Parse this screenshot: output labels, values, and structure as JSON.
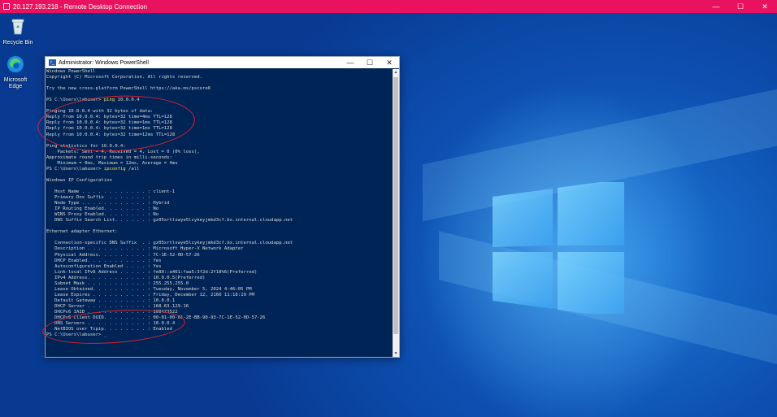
{
  "rdp": {
    "title": "20.127.193.218 - Remote Desktop Connection",
    "controls": [
      "—",
      "☐",
      "✕"
    ]
  },
  "desktop": {
    "icons": [
      {
        "label": "Recycle Bin",
        "icon": "recycle-bin-icon"
      },
      {
        "label": "Microsoft Edge",
        "icon": "edge-icon"
      }
    ]
  },
  "powershell": {
    "title": "Administrator: Windows PowerShell",
    "controls": [
      "—",
      "☐",
      "✕"
    ],
    "lines": [
      {
        "t": "Windows PowerShell"
      },
      {
        "t": "Copyright (C) Microsoft Corporation. All rights reserved."
      },
      {
        "t": ""
      },
      {
        "t": "Try the new cross-platform PowerShell https://aka.ms/pscore6"
      },
      {
        "t": ""
      },
      {
        "t": "PS C:\\Users\\labuser> ",
        "cmd": "ping",
        "arg": " 10.0.0.4"
      },
      {
        "t": ""
      },
      {
        "t": "Pinging 10.0.0.4 with 32 bytes of data:"
      },
      {
        "t": "Reply from 10.0.0.4: bytes=32 time=4ms TTL=128"
      },
      {
        "t": "Reply from 10.0.0.4: bytes=32 time=1ms TTL=128"
      },
      {
        "t": "Reply from 10.0.0.4: bytes=32 time=1ms TTL=128"
      },
      {
        "t": "Reply from 10.0.0.4: bytes=32 time=12ms TTL=128"
      },
      {
        "t": ""
      },
      {
        "t": "Ping statistics for 10.0.0.4:"
      },
      {
        "t": "    Packets: Sent = 4, Received = 4, Lost = 0 (0% loss),"
      },
      {
        "t": "Approximate round trip times in milli-seconds:"
      },
      {
        "t": "    Minimum = 0ms, Maximum = 12ms, Average = 4ms"
      },
      {
        "t": "PS C:\\Users\\labuser> ",
        "cmd": "ipconfig",
        "arg": " /all"
      },
      {
        "t": ""
      },
      {
        "t": "Windows IP Configuration"
      },
      {
        "t": ""
      },
      {
        "t": "   Host Name . . . . . . . . . . . . : client-1"
      },
      {
        "t": "   Primary Dns Suffix  . . . . . . . :"
      },
      {
        "t": "   Node Type . . . . . . . . . . . . : Hybrid"
      },
      {
        "t": "   IP Routing Enabled. . . . . . . . : No"
      },
      {
        "t": "   WINS Proxy Enabled. . . . . . . . : No"
      },
      {
        "t": "   DNS Suffix Search List. . . . . . : gz05xrtlswye5lcykeyjmkd3cf.bx.internal.cloudapp.net"
      },
      {
        "t": ""
      },
      {
        "t": "Ethernet adapter Ethernet:"
      },
      {
        "t": ""
      },
      {
        "t": "   Connection-specific DNS Suffix  . : gz05xrtlswye5lcykeyjmkd3cf.bx.internal.cloudapp.net"
      },
      {
        "t": "   Description . . . . . . . . . . . : Microsoft Hyper-V Network Adapter"
      },
      {
        "t": "   Physical Address. . . . . . . . . : 7C-1E-52-0D-57-26"
      },
      {
        "t": "   DHCP Enabled. . . . . . . . . . . : Yes"
      },
      {
        "t": "   Autoconfiguration Enabled . . . . : Yes"
      },
      {
        "t": "   Link-local IPv6 Address . . . . . : fe80::a461:faa5:3f2d:2f18%6(Preferred)"
      },
      {
        "t": "   IPv4 Address. . . . . . . . . . . : 10.0.0.5(Preferred)"
      },
      {
        "t": "   Subnet Mask . . . . . . . . . . . : 255.255.255.0"
      },
      {
        "t": "   Lease Obtained. . . . . . . . . . : Tuesday, November 5, 2024 4:46:05 PM"
      },
      {
        "t": "   Lease Expires . . . . . . . . . . : Friday, December 12, 2160 11:18:19 PM"
      },
      {
        "t": "   Default Gateway . . . . . . . . . : 10.0.0.1"
      },
      {
        "t": "   DHCP Server . . . . . . . . . . . : 168.63.129.16"
      },
      {
        "t": "   DHCPv6 IAID . . . . . . . . . . . : 100473522"
      },
      {
        "t": "   DHCPv6 Client DUID. . . . . . . . : 00-01-00-01-2E-BB-90-93-7C-1E-52-0D-57-26"
      },
      {
        "t": "   DNS Servers . . . . . . . . . . . : 10.0.0.4"
      },
      {
        "t": "   NetBIOS over Tcpip. . . . . . . . : Enabled"
      },
      {
        "t": "PS C:\\Users\\labuser> _"
      }
    ]
  },
  "colors": {
    "rdp_bar": "#e8125f",
    "console_bg": "#012456",
    "console_text": "#d8d8d8",
    "command": "#f0e040",
    "annotation": "#d9232e"
  }
}
